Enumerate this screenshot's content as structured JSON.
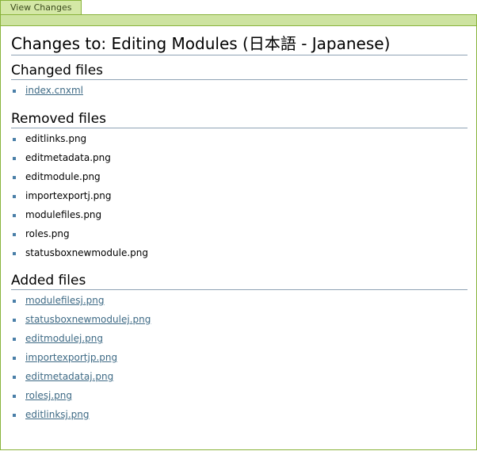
{
  "tab": {
    "label": "View Changes"
  },
  "page": {
    "title": "Changes to: Editing Modules (日本語 - Japanese)"
  },
  "changed": {
    "heading": "Changed files",
    "files": [
      "index.cnxml"
    ]
  },
  "removed": {
    "heading": "Removed files",
    "files": [
      "editlinks.png",
      "editmetadata.png",
      "editmodule.png",
      "importexportj.png",
      "modulefiles.png",
      "roles.png",
      "statusboxnewmodule.png"
    ]
  },
  "added": {
    "heading": "Added files",
    "files": [
      "modulefilesj.png",
      "statusboxnewmodulej.png",
      "editmodulej.png",
      "importexportjp.png",
      "editmetadataj.png",
      "rolesj.png",
      "editlinksj.png"
    ]
  },
  "colors": {
    "tab_bg": "#d4e8a6",
    "border_green": "#89b33b",
    "link": "#3e6a85",
    "bullet": "#4a7fa8",
    "rule": "#8fa3b5"
  }
}
